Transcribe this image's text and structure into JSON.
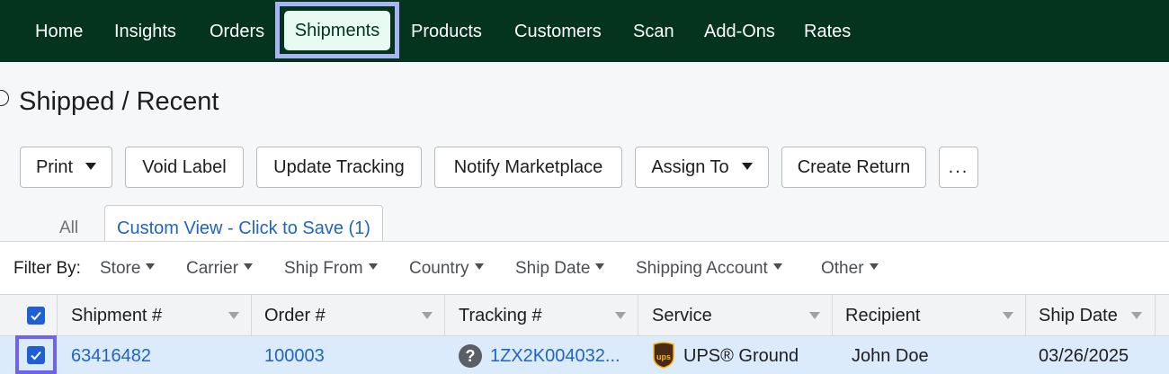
{
  "nav": {
    "items": [
      "Home",
      "Insights",
      "Orders",
      "Shipments",
      "Products",
      "Customers",
      "Scan",
      "Add-Ons",
      "Rates"
    ],
    "active": "Shipments"
  },
  "page": {
    "title": "Shipped / Recent"
  },
  "toolbar": {
    "print": "Print",
    "void_label": "Void Label",
    "update_tracking": "Update Tracking",
    "notify_marketplace": "Notify Marketplace",
    "assign_to": "Assign To",
    "create_return": "Create Return",
    "more": "..."
  },
  "tabs": {
    "all": "All",
    "custom": "Custom View - Click to Save (1)"
  },
  "filters": {
    "label": "Filter By:",
    "items": [
      "Store",
      "Carrier",
      "Ship From",
      "Country",
      "Ship Date",
      "Shipping Account",
      "Other"
    ]
  },
  "table": {
    "columns": [
      "Shipment #",
      "Order #",
      "Tracking #",
      "Service",
      "Recipient",
      "Ship Date"
    ],
    "rows": [
      {
        "selected": true,
        "shipment": "63416482",
        "order": "100003",
        "tracking": "1ZX2K004032...",
        "service": "UPS® Ground",
        "service_icon": "ups-logo-icon",
        "recipient": "John Doe",
        "ship_date": "03/26/2025"
      }
    ]
  },
  "colors": {
    "nav_bg": "#04331e",
    "active_highlight": "#a9b4f5",
    "link": "#1f64c4",
    "checkbox": "#1f5fd6",
    "row_selected": "#dcebfb",
    "row_focus": "#6e62f0"
  }
}
